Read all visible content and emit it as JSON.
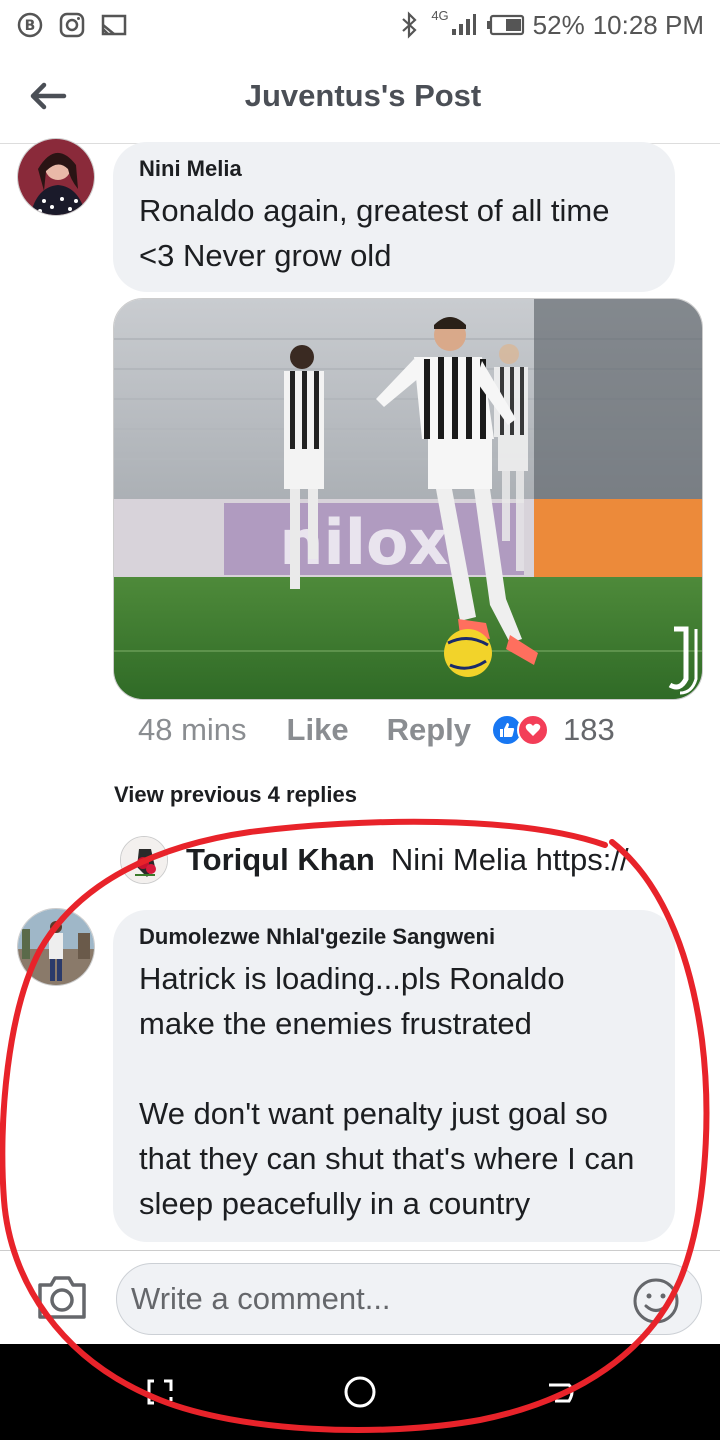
{
  "status_bar": {
    "network": "4G",
    "battery": "52%",
    "time": "10:28 PM"
  },
  "header": {
    "title": "Juventus's Post"
  },
  "comment": {
    "author": "Nini Melia",
    "text": "Ronaldo again, greatest of all time <3 Never grow old",
    "time": "48 mins",
    "like_label": "Like",
    "reply_label": "Reply",
    "reaction_count": "183"
  },
  "photo": {
    "board_text": "nilox"
  },
  "replies": {
    "view_previous": "View previous 4 replies",
    "latest_reply_author": "Toriqul Khan",
    "latest_reply_preview": "Nini Melia https://"
  },
  "comment2": {
    "author": "Dumolezwe Nhlal'gezile Sangweni",
    "text": "Hatrick is loading...pls Ronaldo make the enemies frustrated\n\nWe don't want penalty just goal so that they can shut that's where I can sleep peacefully in a country"
  },
  "composer": {
    "placeholder": "Write a comment..."
  },
  "colors": {
    "like_blue": "#1877f2",
    "love_red": "#f33e58",
    "annotation_red": "#e8232a",
    "bubble_bg": "#eff1f4"
  },
  "icons": {
    "status_left": [
      "b-badge-icon",
      "instagram-icon",
      "cast-icon"
    ],
    "status_right": [
      "bluetooth-icon",
      "signal-icon",
      "battery-icon"
    ],
    "nav": [
      "recent-apps-icon",
      "home-icon",
      "back-nav-icon"
    ]
  }
}
